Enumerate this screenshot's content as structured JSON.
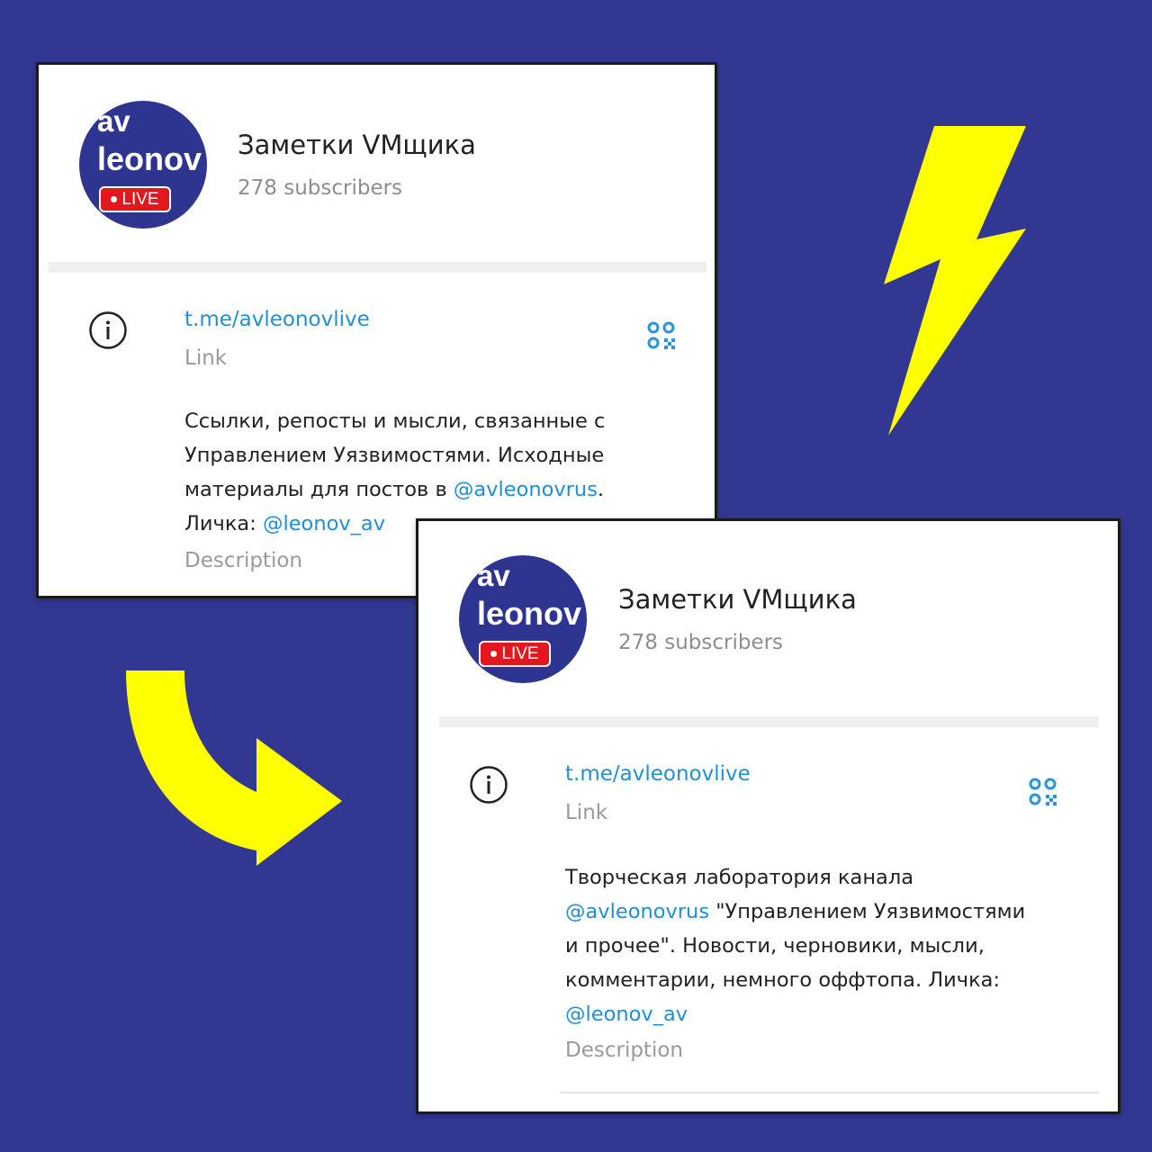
{
  "colors": {
    "background": "#323892",
    "accent_yellow": "#ffff00",
    "link_blue": "#1f8fd6",
    "live_red": "#e3181f"
  },
  "before": {
    "avatar": {
      "line1": "av",
      "line2": "leonov",
      "badge": "LIVE"
    },
    "title": "Заметки VMщика",
    "subscribers": "278 subscribers",
    "link": "t.me/avleonovlive",
    "link_label": "Link",
    "description": {
      "part1": "Ссылки, репосты и мысли, связанные с",
      "part2": "Управлением Уязвимостями. Исходные",
      "part3": "материалы для постов в ",
      "mention1": "@avleonovrus",
      "part4": ".",
      "part5": "Личка: ",
      "mention2": "@leonov_av"
    },
    "description_label": "Description"
  },
  "after": {
    "avatar": {
      "line1": "av",
      "line2": "leonov",
      "badge": "LIVE"
    },
    "title": "Заметки VMщика",
    "subscribers": "278 subscribers",
    "link": "t.me/avleonovlive",
    "link_label": "Link",
    "description": {
      "part1": "Творческая лаборатория канала",
      "mention1": "@avleonovrus",
      "part2": " \"Управлением Уязвимостями",
      "part3": "и прочее\". Новости, черновики, мысли,",
      "part4": "комментарии, немного оффтопа. Личка:",
      "mention2": "@leonov_av"
    },
    "description_label": "Description"
  },
  "icons": {
    "info": "info-circle-icon",
    "qr": "qr-code-icon",
    "lightning": "lightning-bolt-icon",
    "arrow": "curved-arrow-icon"
  }
}
